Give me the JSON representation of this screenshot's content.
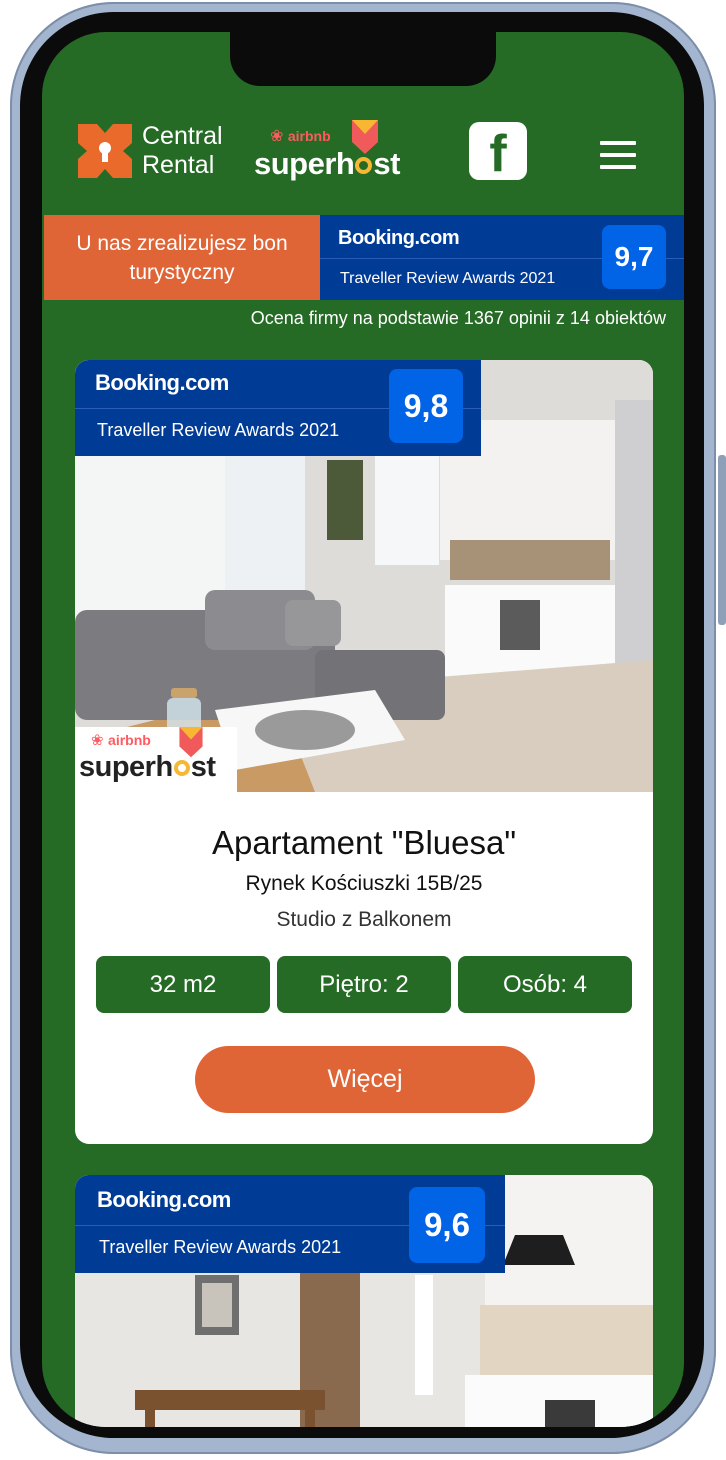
{
  "header": {
    "brand_line1": "Central",
    "brand_line2": "Rental",
    "airbnb_label": "airbnb",
    "superhost_pre": "superh",
    "superhost_post": "st"
  },
  "promo": {
    "line1": "U nas zrealizujesz bon",
    "line2": "turystyczny"
  },
  "company_rating": {
    "brand": "Booking.com",
    "award": "Traveller Review Awards 2021",
    "score": "9,7",
    "note": "Ocena firmy na podstawie 1367 opinii z 14 obiektów"
  },
  "listings": [
    {
      "brand": "Booking.com",
      "award": "Traveller Review Awards 2021",
      "score": "9,8",
      "airbnb_label": "airbnb",
      "superhost_pre": "superh",
      "superhost_post": "st",
      "title": "Apartament \"Bluesa\"",
      "address": "Rynek Kościuszki 15B/25",
      "type": "Studio z Balkonem",
      "area": "32 m2",
      "floor": "Piętro: 2",
      "guests": "Osób: 4",
      "more": "Więcej"
    },
    {
      "brand": "Booking.com",
      "award": "Traveller Review Awards 2021",
      "score": "9,6"
    }
  ],
  "colors": {
    "page_green": "#256b25",
    "accent_orange": "#e06536",
    "booking_blue": "#003b95",
    "score_blue": "#0163e6",
    "airbnb_red": "#ff5a5f"
  },
  "icons": [
    "central-rental-logo-icon",
    "superhost-badge-icon",
    "facebook-icon",
    "hamburger-menu-icon"
  ]
}
